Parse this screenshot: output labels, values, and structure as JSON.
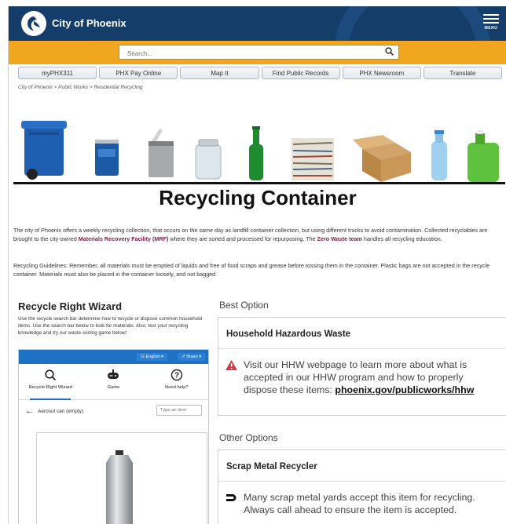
{
  "header": {
    "brand": "City of Phoenix",
    "menu_label": "MENU",
    "search_placeholder": "Search..."
  },
  "nav": [
    "myPHX311",
    "PHX Pay Online",
    "Map It",
    "Find Public Records",
    "PHX Newsroom",
    "Translate"
  ],
  "breadcrumb": "City of Phoenix > Public Works > Residential Recycling",
  "page_title": "Recycling Container",
  "intro": {
    "p1_a": "The city of Phoenix offers a weekly recycling collection, that occurs on the same day as landfill container collection, but using different trucks to avoid contamination. Collected recyclables are brought to the city-owned ",
    "p1_link1": "Materials Recovery Facility (MRF)",
    "p1_b": " where they are sorted and processed for repurposing. The ",
    "p1_link2": "Zero Waste team",
    "p1_c": " handles all recycling education.",
    "p2": "Recycling Guidelines: Remember, all materials must be emptied of liquids and free of food scraps and grease before tossing them in the container. Plastic bags are not accepted in the recycle container. Materials must also be placed in the container loosely, and not bagged."
  },
  "wizard": {
    "title": "Recycle Right Wizard",
    "description": "Use the recycle search bar determine how to recycle or dispose common household items. Use the search bar below to look for materials. Also, test your recycling knowledge and try our waste sorting game below!",
    "lang_button": "English",
    "share_button": "Share",
    "tabs": [
      "Recycle Right Wizard",
      "Game",
      "Need help?"
    ],
    "item_name": "Aerosol can (empty)",
    "type_placeholder": "Type an item"
  },
  "best_option": {
    "label": "Best Option",
    "title": "Household Hazardous Waste",
    "text": "Visit our HHW webpage to learn more about what is accepted in our HHW program and how to properly dispose these items: ",
    "link": "phoenix.gov/publicworks/hhw"
  },
  "other_options": {
    "label": "Other Options",
    "title": "Scrap Metal Recycler",
    "text": "Many scrap metal yards accept this item for recycling. Always call ahead to ensure the item is accepted."
  },
  "colors": {
    "header": "#153d6a",
    "search_band": "#f0a61e",
    "app_bar": "#1e72c6",
    "link_highlight": "#7a1d4a",
    "warning": "#d9363e"
  },
  "icons": [
    "phoenix-bird-logo",
    "menu-icon",
    "search-icon",
    "magnifier-icon",
    "gamepad-icon",
    "help-icon",
    "back-arrow-icon",
    "warning-icon",
    "magnet-icon"
  ]
}
